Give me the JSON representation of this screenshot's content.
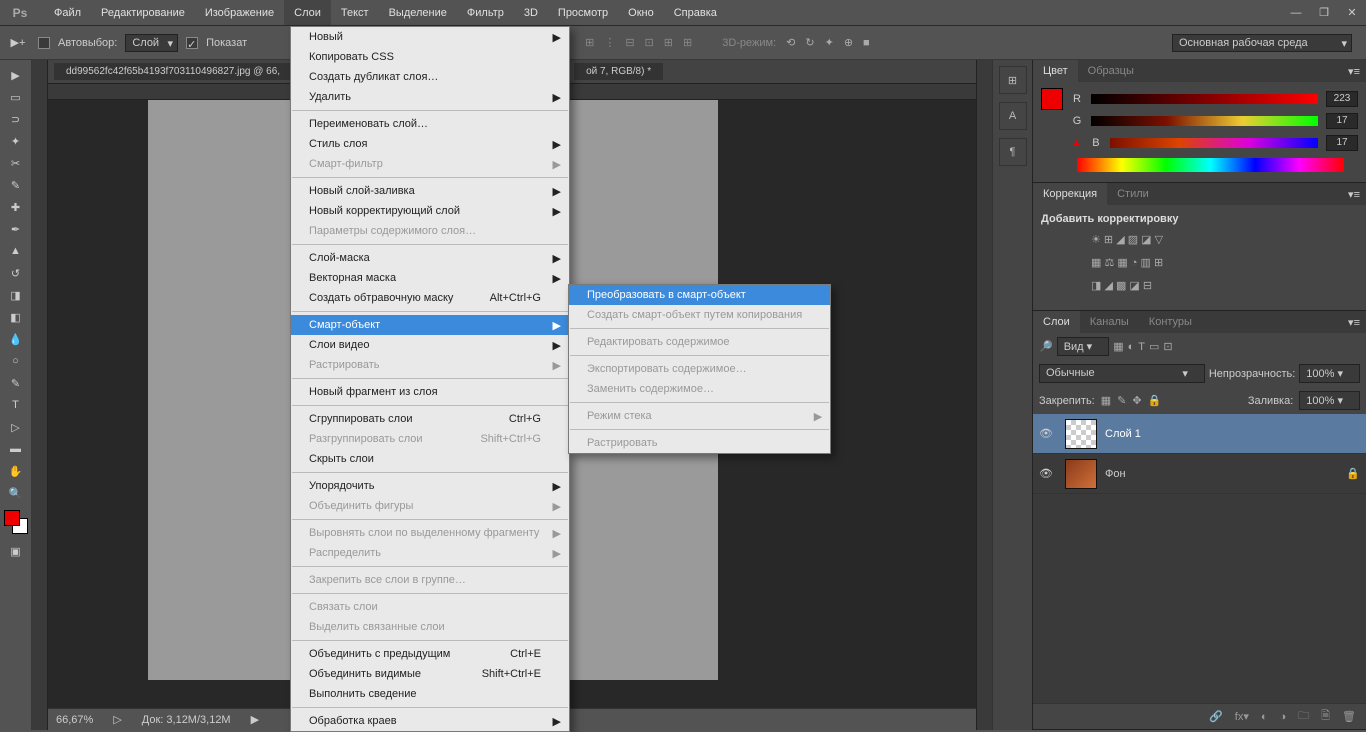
{
  "menubar": {
    "items": [
      "Файл",
      "Редактирование",
      "Изображение",
      "Слои",
      "Текст",
      "Выделение",
      "Фильтр",
      "3D",
      "Просмотр",
      "Окно",
      "Справка"
    ]
  },
  "options": {
    "autoselect": "Автовыбор:",
    "autoselect_val": "Слой",
    "show": "Показат",
    "mode3d": "3D-режим:"
  },
  "workspace": "Основная рабочая среда",
  "doc_tab": "dd99562fc42f65b4193f703110496827.jpg @ 66,",
  "doc_tab2": "ой 7, RGB/8) *",
  "status": {
    "zoom": "66,67%",
    "doc": "Док: 3,12М/3,12М"
  },
  "layers_menu": {
    "items": [
      {
        "t": "Новый",
        "a": true,
        "arr": true
      },
      {
        "t": "Копировать CSS",
        "a": true
      },
      {
        "t": "Создать дубликат слоя…",
        "a": true
      },
      {
        "t": "Удалить",
        "a": true,
        "arr": true
      },
      {
        "sep": true
      },
      {
        "t": "Переименовать слой…",
        "a": true
      },
      {
        "t": "Стиль слоя",
        "a": true,
        "arr": true
      },
      {
        "t": "Смарт-фильтр",
        "a": false,
        "arr": true
      },
      {
        "sep": true
      },
      {
        "t": "Новый слой-заливка",
        "a": true,
        "arr": true
      },
      {
        "t": "Новый корректирующий слой",
        "a": true,
        "arr": true
      },
      {
        "t": "Параметры содержимого слоя…",
        "a": false
      },
      {
        "sep": true
      },
      {
        "t": "Слой-маска",
        "a": true,
        "arr": true
      },
      {
        "t": "Векторная маска",
        "a": true,
        "arr": true
      },
      {
        "t": "Создать обтравочную маску",
        "a": true,
        "sc": "Alt+Ctrl+G"
      },
      {
        "sep": true
      },
      {
        "t": "Смарт-объект",
        "a": true,
        "arr": true,
        "hl": true
      },
      {
        "t": "Слои видео",
        "a": true,
        "arr": true
      },
      {
        "t": "Растрировать",
        "a": false,
        "arr": true
      },
      {
        "sep": true
      },
      {
        "t": "Новый фрагмент из слоя",
        "a": true
      },
      {
        "sep": true
      },
      {
        "t": "Сгруппировать слои",
        "a": true,
        "sc": "Ctrl+G"
      },
      {
        "t": "Разгруппировать слои",
        "a": false,
        "sc": "Shift+Ctrl+G"
      },
      {
        "t": "Скрыть слои",
        "a": true
      },
      {
        "sep": true
      },
      {
        "t": "Упорядочить",
        "a": true,
        "arr": true
      },
      {
        "t": "Объединить фигуры",
        "a": false,
        "arr": true
      },
      {
        "sep": true
      },
      {
        "t": "Выровнять слои по выделенному фрагменту",
        "a": false,
        "arr": true
      },
      {
        "t": "Распределить",
        "a": false,
        "arr": true
      },
      {
        "sep": true
      },
      {
        "t": "Закрепить все слои в группе…",
        "a": false
      },
      {
        "sep": true
      },
      {
        "t": "Связать слои",
        "a": false
      },
      {
        "t": "Выделить связанные слои",
        "a": false
      },
      {
        "sep": true
      },
      {
        "t": "Объединить с предыдущим",
        "a": true,
        "sc": "Ctrl+E"
      },
      {
        "t": "Объединить видимые",
        "a": true,
        "sc": "Shift+Ctrl+E"
      },
      {
        "t": "Выполнить сведение",
        "a": true
      },
      {
        "sep": true
      },
      {
        "t": "Обработка краев",
        "a": true,
        "arr": true
      }
    ]
  },
  "smart_submenu": {
    "items": [
      {
        "t": "Преобразовать в смарт-объект",
        "a": true,
        "hl": true
      },
      {
        "t": "Создать смарт-объект путем копирования",
        "a": false
      },
      {
        "sep": true
      },
      {
        "t": "Редактировать содержимое",
        "a": false
      },
      {
        "sep": true
      },
      {
        "t": "Экспортировать содержимое…",
        "a": false
      },
      {
        "t": "Заменить содержимое…",
        "a": false
      },
      {
        "sep": true
      },
      {
        "t": "Режим стека",
        "a": false,
        "arr": true
      },
      {
        "sep": true
      },
      {
        "t": "Растрировать",
        "a": false
      }
    ]
  },
  "panels": {
    "color_tab": "Цвет",
    "swatches_tab": "Образцы",
    "r": "R",
    "g": "G",
    "b": "B",
    "r_val": "223",
    "g_val": "17",
    "b_val": "17",
    "adjust_tab": "Коррекция",
    "styles_tab": "Стили",
    "adjust_title": "Добавить корректировку",
    "layers_tab": "Слои",
    "channels_tab": "Каналы",
    "paths_tab": "Контуры",
    "filter": "Вид",
    "blend": "Обычные",
    "opacity_label": "Непрозрачность:",
    "opacity_val": "100%",
    "lock_label": "Закрепить:",
    "fill_label": "Заливка:",
    "fill_val": "100%",
    "layer1": "Слой 1",
    "layer_bg": "Фон"
  }
}
